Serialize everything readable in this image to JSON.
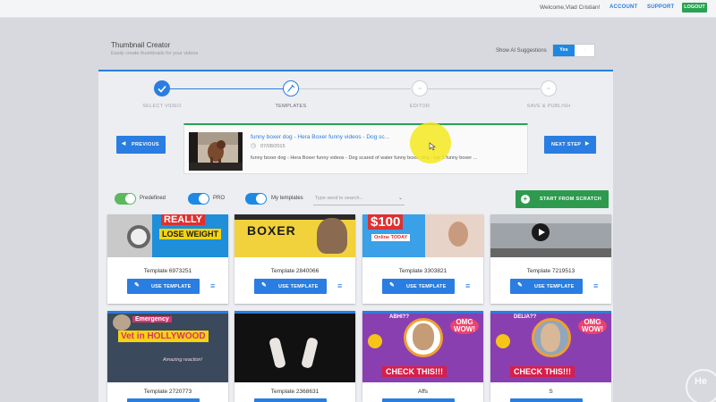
{
  "topbar": {
    "welcome": "Welcome,Vlad Cristian!",
    "account": "ACCOUNT",
    "support": "SUPPORT",
    "logout": "LOGOUT"
  },
  "header": {
    "title": "Thumbnail Creator",
    "subtitle": "Easily create thumbnails for your videos",
    "ai_label": "Show AI Suggestions",
    "ai_yes": "Yes",
    "ai_no": "·"
  },
  "steps": [
    {
      "label": "SELECT VIDEO",
      "state": "done"
    },
    {
      "label": "TEMPLATES",
      "state": "current"
    },
    {
      "label": "EDITOR",
      "state": "pending"
    },
    {
      "label": "SAVE & PUBLISH",
      "state": "pending"
    }
  ],
  "nav": {
    "previous": "PREVIOUS",
    "next": "NEXT STEP"
  },
  "video": {
    "title": "funny boxer dog - Hera Boxer funny videos - Dog sc...",
    "date": "07/08/2015",
    "description": "funny boxer dog - Hera Boxer funny videos - Dog scared of water funny boxer dog - top 5 funny boxer ..."
  },
  "filters": {
    "predefined": "Predefined",
    "pro": "PRO",
    "my_templates": "My templates",
    "search_placeholder": "Type word to search...",
    "scratch": "START FROM SCRATCH"
  },
  "templates": {
    "use_label": "USE TEMPLATE",
    "row1": [
      {
        "name": "Template 6973251",
        "text1": "REALLY",
        "text2": "LOSE WEIGHT"
      },
      {
        "name": "Template 2840066",
        "text1": "BOXER",
        "text2": ""
      },
      {
        "name": "Template 3303821",
        "text1": "$100",
        "text2": "Online TODAY"
      },
      {
        "name": "Template 7219513",
        "text1": "",
        "text2": ""
      }
    ],
    "row2": [
      {
        "name": "Template 2720773",
        "text1": "Emergency",
        "text2": "Vet in HOLLYWOOD",
        "text3": "Amazing reaction!"
      },
      {
        "name": "Template 2368631"
      },
      {
        "name": "Affs",
        "text1": "ABHI??",
        "text2": "OMG WOW!",
        "text3": "CHECK THIS!!!"
      },
      {
        "name": "S",
        "text1": "DELIA??",
        "text2": "OMG WOW!",
        "text3": "CHECK THIS!!!"
      }
    ]
  },
  "watermark": "He",
  "colors": {
    "accent": "#2a7de1",
    "green": "#27a352",
    "highlight": "#f5e81e"
  }
}
